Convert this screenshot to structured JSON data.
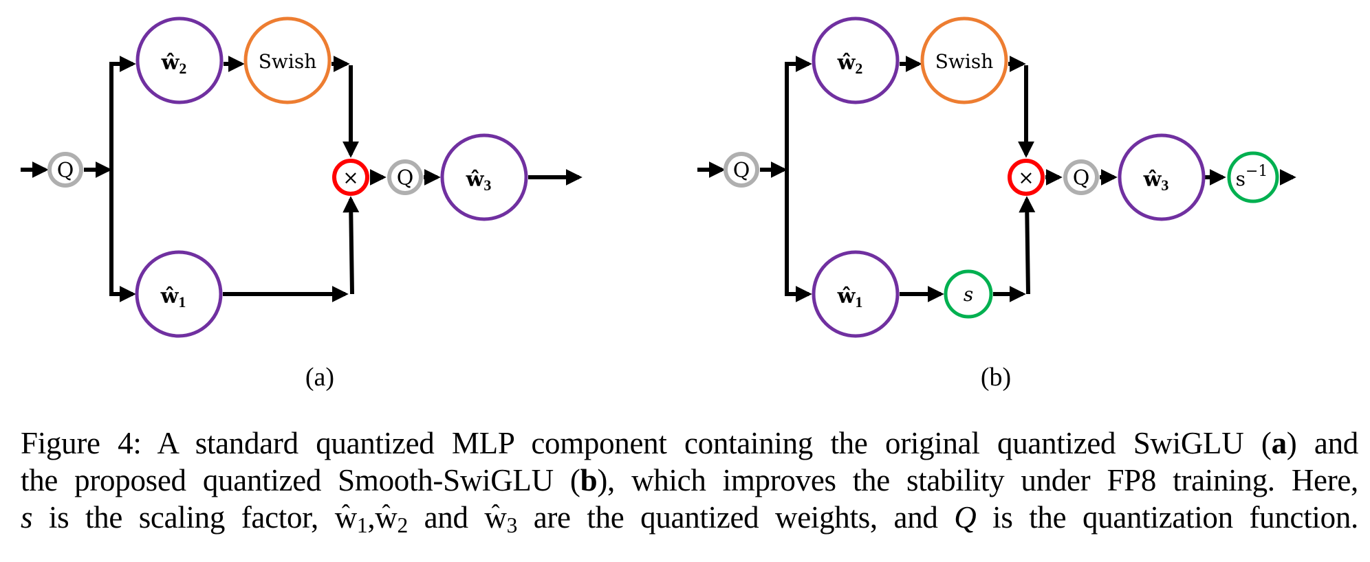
{
  "colors": {
    "weight_node": "#7030A0",
    "activation_node": "#ED7D31",
    "quant_node": "#AFAFAF",
    "multiply_node": "#FF0000",
    "scale_node": "#00B050",
    "arrow": "#000000"
  },
  "panels": [
    {
      "id": "a",
      "label": "(a)",
      "nodes": {
        "q_in": {
          "text": "Q"
        },
        "w2": {
          "text": "ŵ",
          "sub": "2"
        },
        "swish": {
          "text": "Swish"
        },
        "w1": {
          "text": "ŵ",
          "sub": "1"
        },
        "mul": {
          "text": "×"
        },
        "q_out": {
          "text": "Q"
        },
        "w3": {
          "text": "ŵ",
          "sub": "3"
        }
      }
    },
    {
      "id": "b",
      "label": "(b)",
      "nodes": {
        "q_in": {
          "text": "Q"
        },
        "w2": {
          "text": "ŵ",
          "sub": "2"
        },
        "swish": {
          "text": "Swish"
        },
        "w1": {
          "text": "ŵ",
          "sub": "1"
        },
        "scale": {
          "text": "s"
        },
        "mul": {
          "text": "×"
        },
        "q_out": {
          "text": "Q"
        },
        "w3": {
          "text": "ŵ",
          "sub": "3"
        },
        "inv_scale": {
          "text": "s",
          "sup": "−1"
        }
      }
    }
  ],
  "caption": {
    "prefix": "Figure 4:",
    "line1_a": "A standard quantized MLP component containing the original quantized SwiGLU (",
    "line1_bold": "a",
    "line1_b": ") and",
    "line2_a": "the proposed quantized Smooth-SwiGLU (",
    "line2_bold": "b",
    "line2_b": "), which improves the stability under FP8 training. Here,",
    "line3_s": "s",
    "line3_a": " is the scaling factor, ",
    "w": "w",
    "sub1": "1",
    "comma": ",",
    "sub2": "2",
    "and1": " and ",
    "sub3": "3",
    "line3_b": " are the quantized weights, and ",
    "line3_q": "Q",
    "line3_c": " is the quantization function."
  }
}
